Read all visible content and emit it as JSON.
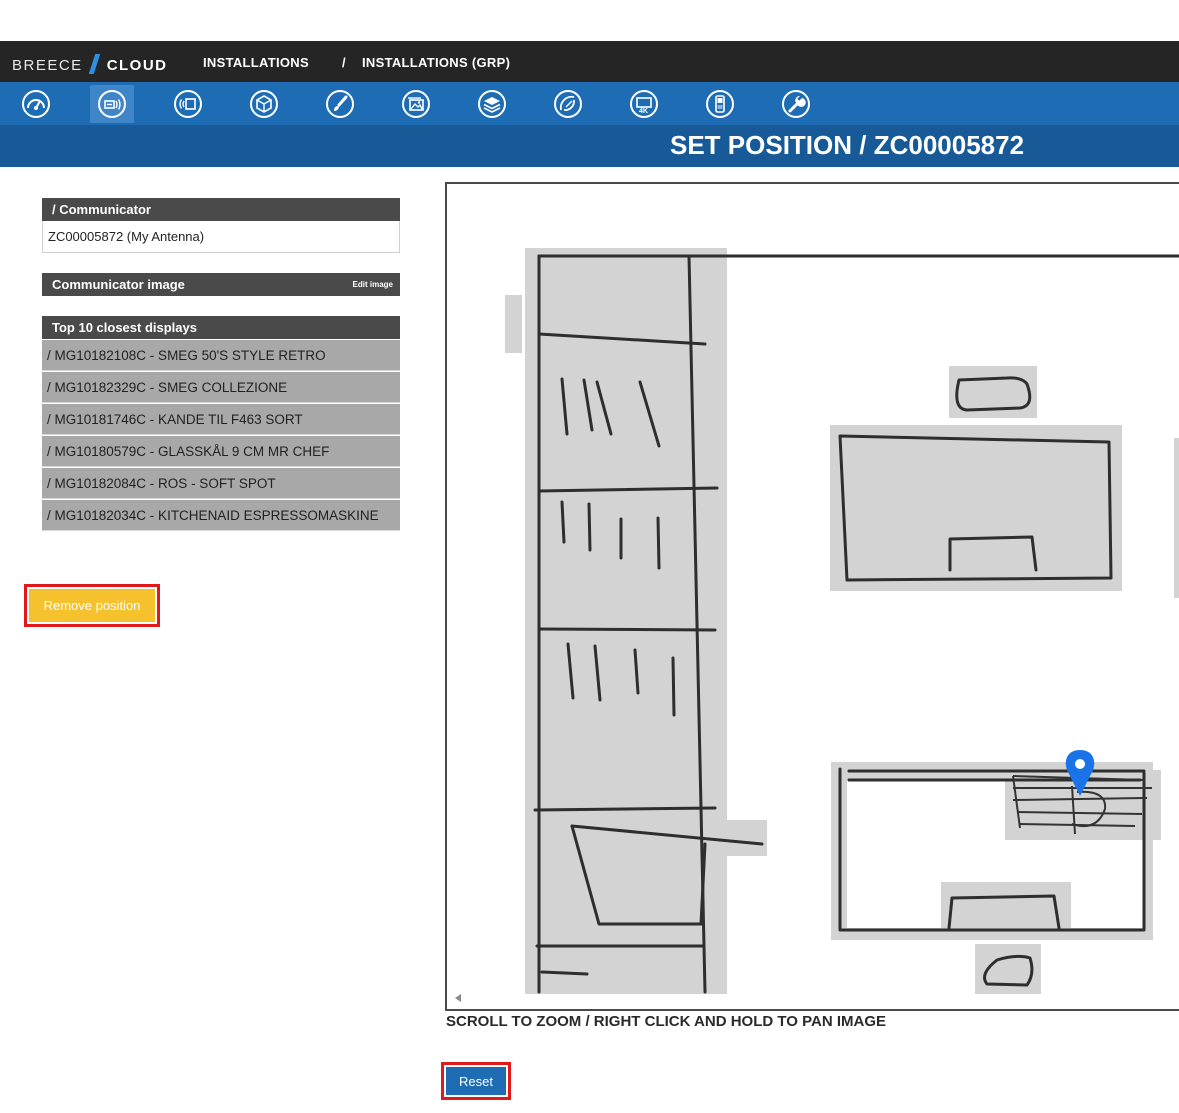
{
  "header": {
    "brand_left": "BREECE",
    "brand_right": "CLOUD",
    "breadcrumb": [
      {
        "label": "INSTALLATIONS"
      },
      {
        "label": "/"
      },
      {
        "label": "INSTALLATIONS (GRP)"
      }
    ]
  },
  "toolbar": {
    "icons": [
      "dashboard-gauge-icon",
      "communicator-icon",
      "antenna-signal-icon",
      "box-icon",
      "paint-brush-icon",
      "image-gallery-icon",
      "layers-icon",
      "satellite-dish-icon",
      "4k-monitor-icon",
      "handheld-device-icon",
      "wrench-icon"
    ],
    "active_index": 1,
    "color_bar": "#1e6db4",
    "color_active": "#3f86c8"
  },
  "page_title": "SET POSITION / ZC00005872",
  "communicator": {
    "header": "/ Communicator",
    "value": "ZC00005872 (My Antenna)"
  },
  "communicator_image": {
    "header": "Communicator image",
    "edit_label": "Edit image"
  },
  "displays": {
    "header": "Top 10 closest displays",
    "items": [
      "/ MG10182108C - SMEG 50'S STYLE RETRO",
      "/ MG10182329C - SMEG COLLEZIONE",
      "/ MG10181746C - KANDE TIL F463 SORT",
      "/ MG10180579C - GLASSKÅL 9 CM MR CHEF",
      "/ MG10182084C - ROS - SOFT SPOT",
      "/ MG10182034C - KITCHENAID ESPRESSOMASKINE"
    ]
  },
  "buttons": {
    "remove_position": "Remove position",
    "reset": "Reset"
  },
  "map": {
    "hint": "SCROLL TO ZOOM / RIGHT CLICK AND HOLD TO PAN IMAGE",
    "marker_color": "#1a73e8"
  }
}
